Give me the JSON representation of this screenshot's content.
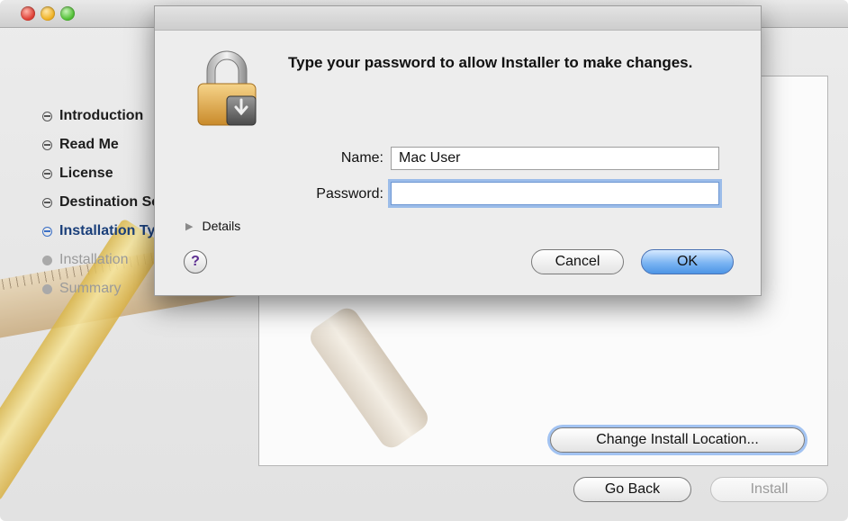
{
  "window": {
    "traffic_lights": [
      "close",
      "minimize",
      "zoom"
    ]
  },
  "steps": [
    {
      "label": "Introduction",
      "state": "done"
    },
    {
      "label": "Read Me",
      "state": "done"
    },
    {
      "label": "License",
      "state": "done"
    },
    {
      "label": "Destination Select",
      "state": "done"
    },
    {
      "label": "Installation Type",
      "state": "current"
    },
    {
      "label": "Installation",
      "state": "pending"
    },
    {
      "label": "Summary",
      "state": "pending"
    }
  ],
  "main": {
    "change_location_label": "Change Install Location...",
    "go_back_label": "Go Back",
    "install_label": "Install"
  },
  "dialog": {
    "message": "Type your password to allow Installer to make changes.",
    "name_label": "Name:",
    "name_value": "Mac User",
    "password_label": "Password:",
    "password_value": "",
    "details_label": "Details",
    "help_symbol": "?",
    "cancel_label": "Cancel",
    "ok_label": "OK",
    "icon": "lock-icon"
  },
  "colors": {
    "accent": "#4d95e6",
    "current_step": "#1a3f7a"
  }
}
